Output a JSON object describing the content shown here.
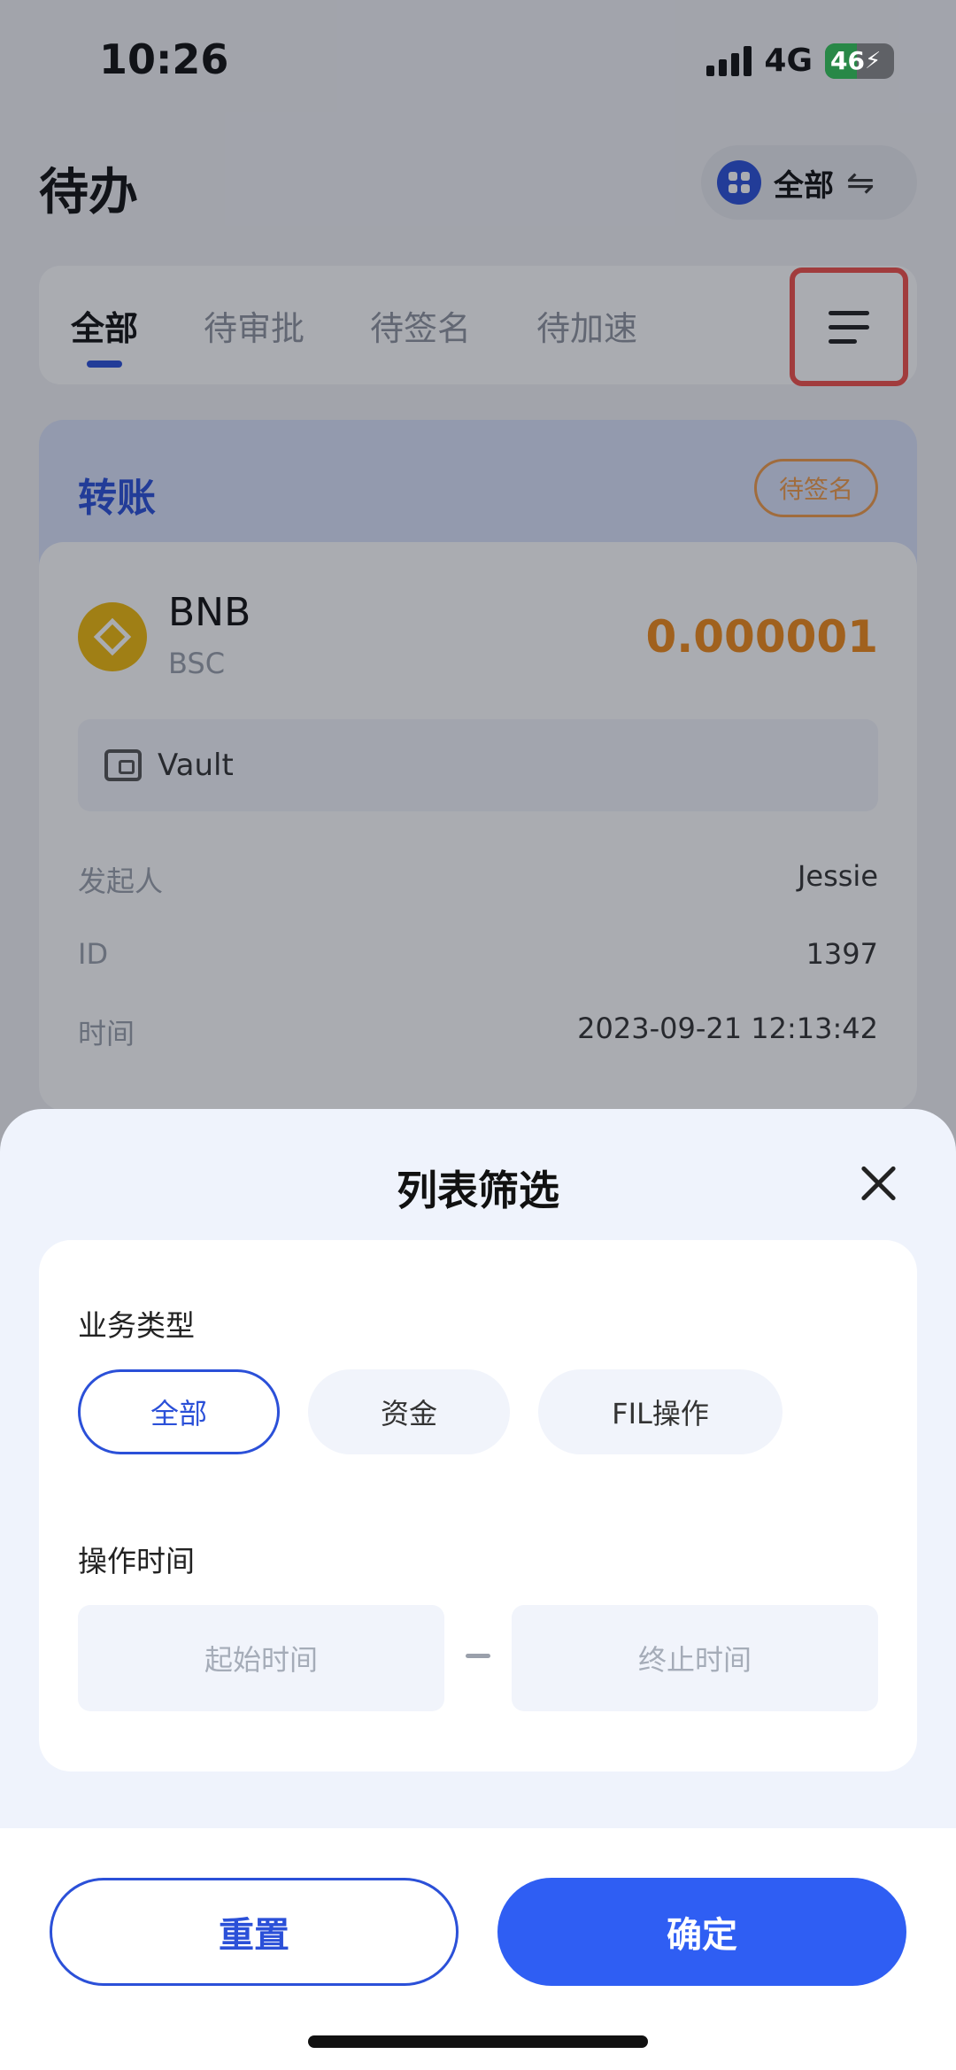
{
  "status_bar": {
    "time": "10:26",
    "network": "4G",
    "battery": "46"
  },
  "header": {
    "title": "待办",
    "account_label": "全部"
  },
  "tabs": [
    {
      "label": "全部"
    },
    {
      "label": "待审批"
    },
    {
      "label": "待签名"
    },
    {
      "label": "待加速"
    }
  ],
  "todo": {
    "type": "转账",
    "status": "待签名",
    "coin": "BNB",
    "chain": "BSC",
    "amount": "0.000001",
    "wallet": "Vault",
    "rows": [
      {
        "label": "发起人",
        "value": "Jessie"
      },
      {
        "label": "ID",
        "value": "1397"
      },
      {
        "label": "时间",
        "value": "2023-09-21 12:13:42"
      }
    ]
  },
  "sheet": {
    "title": "列表筛选",
    "business_type_label": "业务类型",
    "business_types": [
      "全部",
      "资金",
      "FIL操作"
    ],
    "selected_business_type": "全部",
    "time_label": "操作时间",
    "start_placeholder": "起始时间",
    "end_placeholder": "终止时间",
    "reset_label": "重置",
    "confirm_label": "确定"
  },
  "colors": {
    "accent": "#2b50d8",
    "confirm": "#2f5ef3",
    "amount": "#ef8a1a",
    "highlight_border": "#f1504a"
  }
}
